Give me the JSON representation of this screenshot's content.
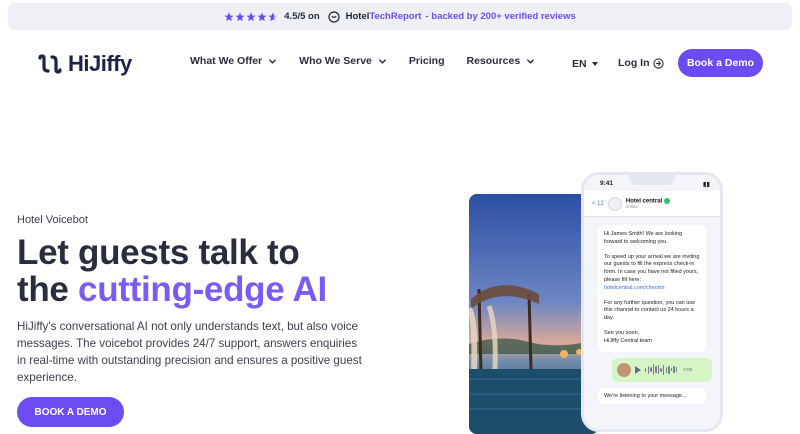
{
  "banner": {
    "rating": "4.5/5 on",
    "review_brand_prefix": "Hotel",
    "review_brand_suffix": "TechReport",
    "backed": "- backed by 200+ verified reviews",
    "star_count": 5,
    "star_color": "#6c4cf1"
  },
  "header": {
    "logo_text": "HiJiffy",
    "nav": [
      {
        "label": "What We Offer",
        "has_dropdown": true
      },
      {
        "label": "Who We Serve",
        "has_dropdown": true
      },
      {
        "label": "Pricing",
        "has_dropdown": false
      },
      {
        "label": "Resources",
        "has_dropdown": true
      }
    ],
    "language": "EN",
    "login": "Log In",
    "demo_button": "Book a Demo"
  },
  "hero": {
    "kicker": "Hotel Voicebot",
    "headline_line1": "Let guests talk to",
    "headline_line2_plain": "the ",
    "headline_line2_accent": "cutting-edge AI",
    "lead": "HiJiffy's conversational AI not only understands text, but also voice messages. The voicebot provides 24/7 support, answers enquiries in real-time with outstanding precision and ensures a positive guest experience.",
    "cta": "BOOK A DEMO"
  },
  "phone": {
    "time": "9:41",
    "back": "< 12",
    "contact_name": "Hotel central",
    "contact_sub": "online",
    "messages": [
      "Hi James Smith! We are looking forward to welcoming you.",
      "To speed up your arrival we are inviting our guests to fill the express check-in form. In case you have not filled yours, please fill here:",
      "hotelcentral.com/checkin",
      "For any further question, you can use this channel to contact us 24 hours a day.",
      "See you soon,",
      "HiJiffy Central team"
    ],
    "voice_duration": "0:05",
    "listening": "We're listening to your message..."
  },
  "colors": {
    "accent": "#6c4cf1",
    "headline_accent": "#7b5cf3",
    "banner_bg": "#eef0f6"
  }
}
